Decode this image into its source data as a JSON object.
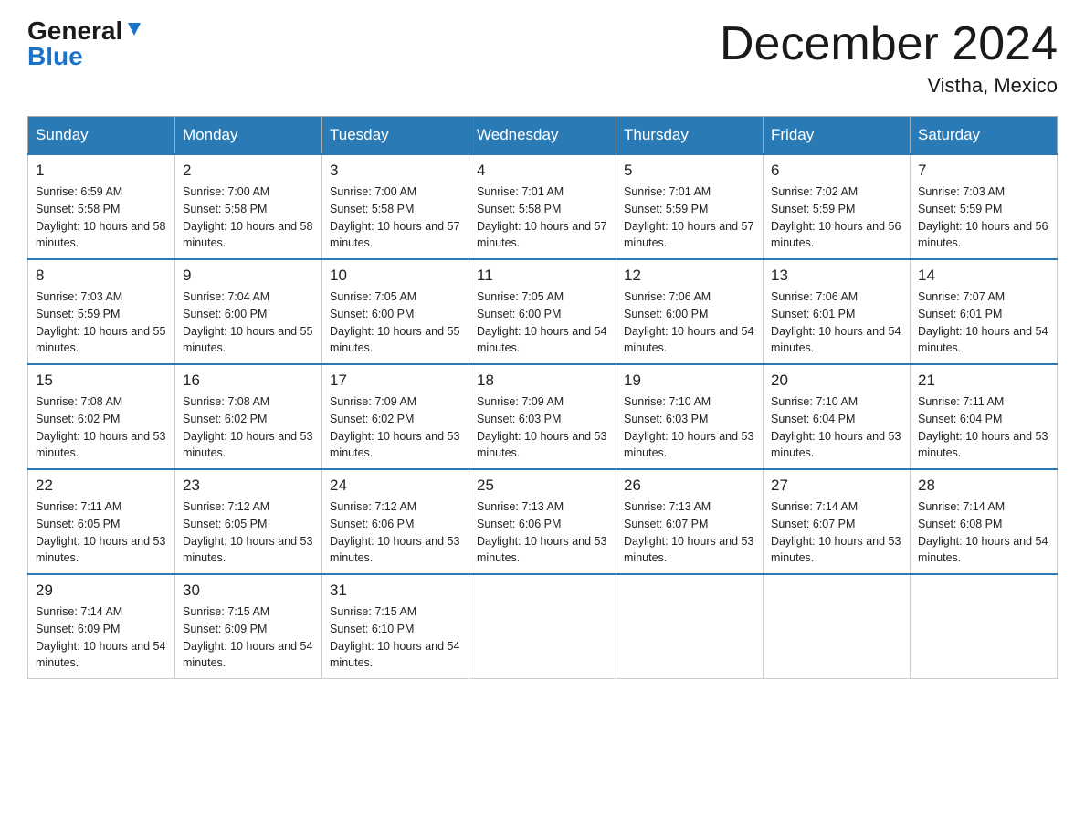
{
  "logo": {
    "general": "General",
    "blue": "Blue"
  },
  "header": {
    "month_title": "December 2024",
    "subtitle": "Vistha, Mexico"
  },
  "days_of_week": [
    "Sunday",
    "Monday",
    "Tuesday",
    "Wednesday",
    "Thursday",
    "Friday",
    "Saturday"
  ],
  "weeks": [
    [
      {
        "day": "1",
        "sunrise": "6:59 AM",
        "sunset": "5:58 PM",
        "daylight": "10 hours and 58 minutes."
      },
      {
        "day": "2",
        "sunrise": "7:00 AM",
        "sunset": "5:58 PM",
        "daylight": "10 hours and 58 minutes."
      },
      {
        "day": "3",
        "sunrise": "7:00 AM",
        "sunset": "5:58 PM",
        "daylight": "10 hours and 57 minutes."
      },
      {
        "day": "4",
        "sunrise": "7:01 AM",
        "sunset": "5:58 PM",
        "daylight": "10 hours and 57 minutes."
      },
      {
        "day": "5",
        "sunrise": "7:01 AM",
        "sunset": "5:59 PM",
        "daylight": "10 hours and 57 minutes."
      },
      {
        "day": "6",
        "sunrise": "7:02 AM",
        "sunset": "5:59 PM",
        "daylight": "10 hours and 56 minutes."
      },
      {
        "day": "7",
        "sunrise": "7:03 AM",
        "sunset": "5:59 PM",
        "daylight": "10 hours and 56 minutes."
      }
    ],
    [
      {
        "day": "8",
        "sunrise": "7:03 AM",
        "sunset": "5:59 PM",
        "daylight": "10 hours and 55 minutes."
      },
      {
        "day": "9",
        "sunrise": "7:04 AM",
        "sunset": "6:00 PM",
        "daylight": "10 hours and 55 minutes."
      },
      {
        "day": "10",
        "sunrise": "7:05 AM",
        "sunset": "6:00 PM",
        "daylight": "10 hours and 55 minutes."
      },
      {
        "day": "11",
        "sunrise": "7:05 AM",
        "sunset": "6:00 PM",
        "daylight": "10 hours and 54 minutes."
      },
      {
        "day": "12",
        "sunrise": "7:06 AM",
        "sunset": "6:00 PM",
        "daylight": "10 hours and 54 minutes."
      },
      {
        "day": "13",
        "sunrise": "7:06 AM",
        "sunset": "6:01 PM",
        "daylight": "10 hours and 54 minutes."
      },
      {
        "day": "14",
        "sunrise": "7:07 AM",
        "sunset": "6:01 PM",
        "daylight": "10 hours and 54 minutes."
      }
    ],
    [
      {
        "day": "15",
        "sunrise": "7:08 AM",
        "sunset": "6:02 PM",
        "daylight": "10 hours and 53 minutes."
      },
      {
        "day": "16",
        "sunrise": "7:08 AM",
        "sunset": "6:02 PM",
        "daylight": "10 hours and 53 minutes."
      },
      {
        "day": "17",
        "sunrise": "7:09 AM",
        "sunset": "6:02 PM",
        "daylight": "10 hours and 53 minutes."
      },
      {
        "day": "18",
        "sunrise": "7:09 AM",
        "sunset": "6:03 PM",
        "daylight": "10 hours and 53 minutes."
      },
      {
        "day": "19",
        "sunrise": "7:10 AM",
        "sunset": "6:03 PM",
        "daylight": "10 hours and 53 minutes."
      },
      {
        "day": "20",
        "sunrise": "7:10 AM",
        "sunset": "6:04 PM",
        "daylight": "10 hours and 53 minutes."
      },
      {
        "day": "21",
        "sunrise": "7:11 AM",
        "sunset": "6:04 PM",
        "daylight": "10 hours and 53 minutes."
      }
    ],
    [
      {
        "day": "22",
        "sunrise": "7:11 AM",
        "sunset": "6:05 PM",
        "daylight": "10 hours and 53 minutes."
      },
      {
        "day": "23",
        "sunrise": "7:12 AM",
        "sunset": "6:05 PM",
        "daylight": "10 hours and 53 minutes."
      },
      {
        "day": "24",
        "sunrise": "7:12 AM",
        "sunset": "6:06 PM",
        "daylight": "10 hours and 53 minutes."
      },
      {
        "day": "25",
        "sunrise": "7:13 AM",
        "sunset": "6:06 PM",
        "daylight": "10 hours and 53 minutes."
      },
      {
        "day": "26",
        "sunrise": "7:13 AM",
        "sunset": "6:07 PM",
        "daylight": "10 hours and 53 minutes."
      },
      {
        "day": "27",
        "sunrise": "7:14 AM",
        "sunset": "6:07 PM",
        "daylight": "10 hours and 53 minutes."
      },
      {
        "day": "28",
        "sunrise": "7:14 AM",
        "sunset": "6:08 PM",
        "daylight": "10 hours and 54 minutes."
      }
    ],
    [
      {
        "day": "29",
        "sunrise": "7:14 AM",
        "sunset": "6:09 PM",
        "daylight": "10 hours and 54 minutes."
      },
      {
        "day": "30",
        "sunrise": "7:15 AM",
        "sunset": "6:09 PM",
        "daylight": "10 hours and 54 minutes."
      },
      {
        "day": "31",
        "sunrise": "7:15 AM",
        "sunset": "6:10 PM",
        "daylight": "10 hours and 54 minutes."
      },
      null,
      null,
      null,
      null
    ]
  ]
}
